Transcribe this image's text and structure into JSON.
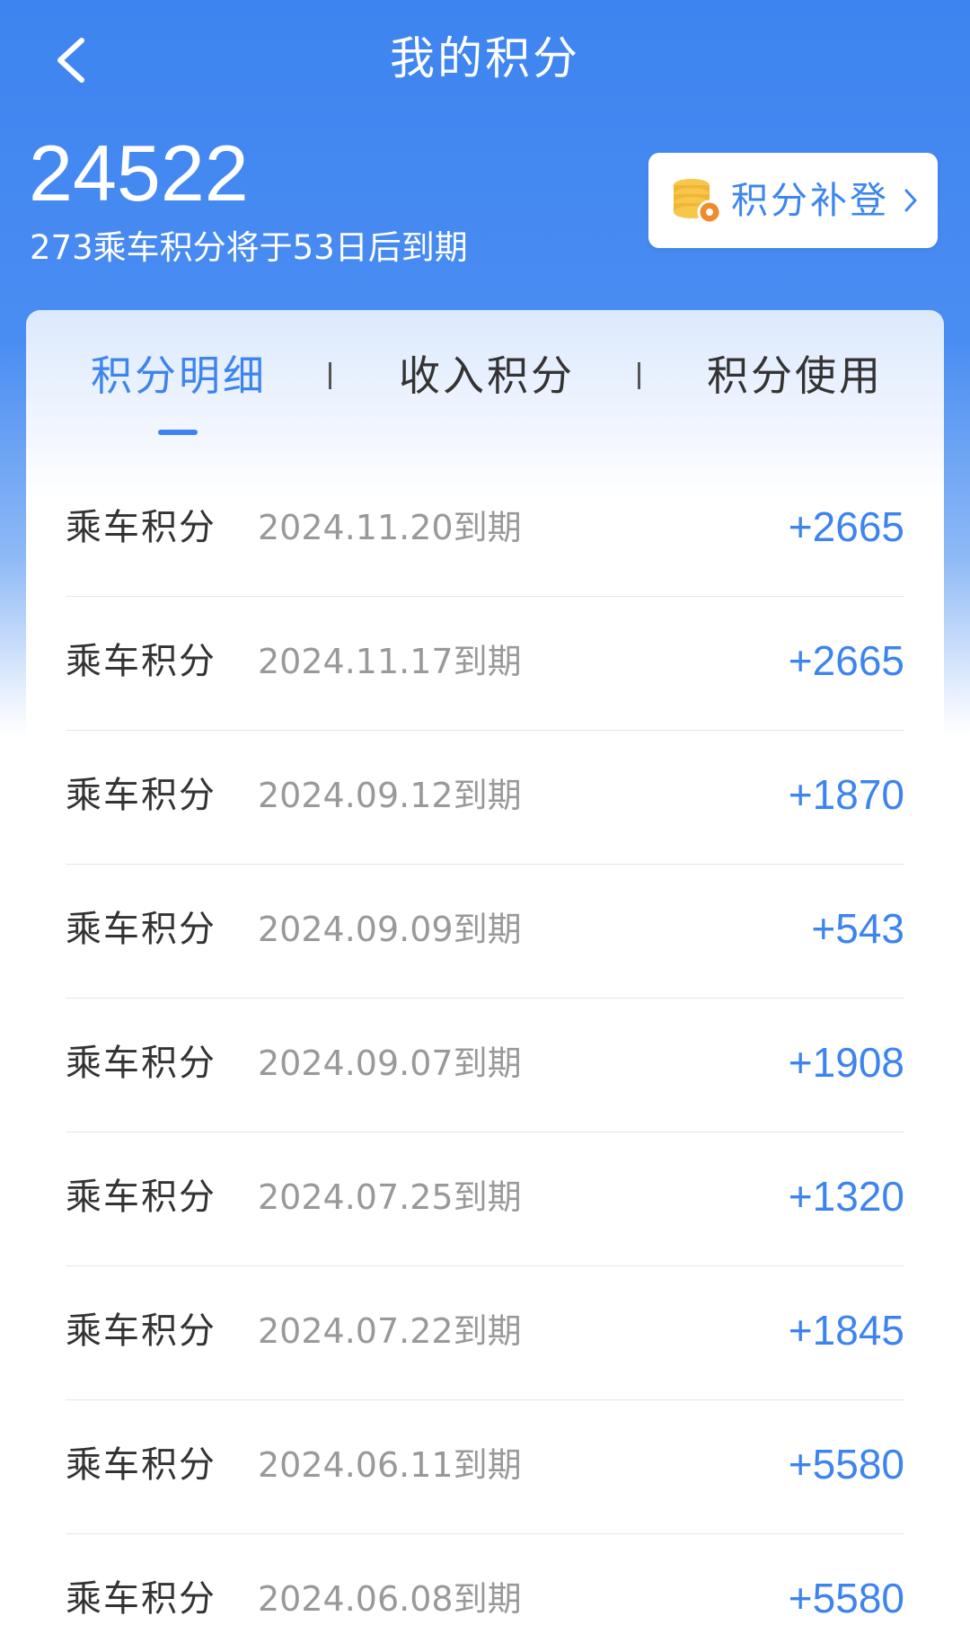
{
  "header": {
    "title": "我的积分",
    "back_icon": "chevron-left-icon"
  },
  "summary": {
    "total_points": "24522",
    "expire_note": "273乘车积分将于53日后到期"
  },
  "makeup_button": {
    "label": "积分补登",
    "icon": "coin-stack-icon"
  },
  "tabs": [
    {
      "label": "积分明细",
      "active": true
    },
    {
      "label": "收入积分",
      "active": false
    },
    {
      "label": "积分使用",
      "active": false
    }
  ],
  "records": [
    {
      "title": "乘车积分",
      "date": "2024.11.20到期",
      "value": "+2665"
    },
    {
      "title": "乘车积分",
      "date": "2024.11.17到期",
      "value": "+2665"
    },
    {
      "title": "乘车积分",
      "date": "2024.09.12到期",
      "value": "+1870"
    },
    {
      "title": "乘车积分",
      "date": "2024.09.09到期",
      "value": "+543"
    },
    {
      "title": "乘车积分",
      "date": "2024.09.07到期",
      "value": "+1908"
    },
    {
      "title": "乘车积分",
      "date": "2024.07.25到期",
      "value": "+1320"
    },
    {
      "title": "乘车积分",
      "date": "2024.07.22到期",
      "value": "+1845"
    },
    {
      "title": "乘车积分",
      "date": "2024.06.11到期",
      "value": "+5580"
    },
    {
      "title": "乘车积分",
      "date": "2024.06.08到期",
      "value": "+5580"
    }
  ],
  "colors": {
    "primary": "#3E84EE",
    "header_bg": "#3E84F0",
    "date_text": "#999999"
  }
}
